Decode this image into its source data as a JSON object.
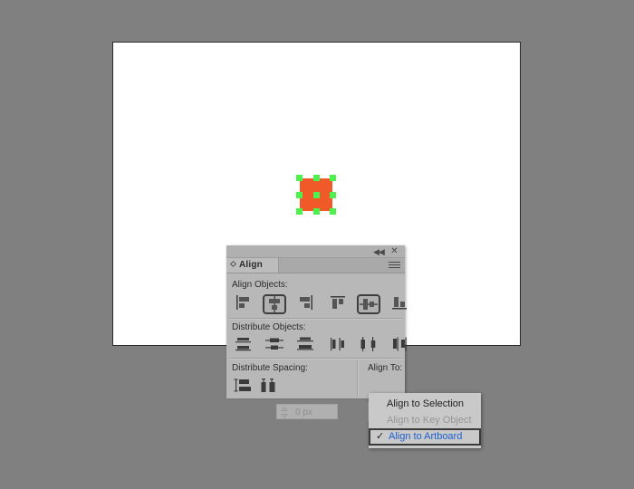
{
  "app": {
    "background_color": "#808080",
    "artboard_color": "#ffffff"
  },
  "shape": {
    "fill_color": "#ef5a28",
    "handle_color": "#4ef04e",
    "name": "selected-rectangle"
  },
  "panel": {
    "tab_label": "Align",
    "titlebar": {
      "collapse_icon": "◀◀",
      "close_icon": "✕"
    },
    "menu_icon": "panel-options-icon",
    "sections": {
      "align_objects_label": "Align Objects:",
      "distribute_objects_label": "Distribute Objects:",
      "distribute_spacing_label": "Distribute Spacing:",
      "align_to_label": "Align To:"
    },
    "align_objects_buttons": [
      {
        "name": "horizontal-align-left",
        "selected": false
      },
      {
        "name": "horizontal-align-center",
        "selected": true
      },
      {
        "name": "horizontal-align-right",
        "selected": false
      },
      {
        "name": "vertical-align-top",
        "selected": false
      },
      {
        "name": "vertical-align-center",
        "selected": true
      },
      {
        "name": "vertical-align-bottom",
        "selected": false
      }
    ],
    "distribute_objects_buttons": [
      {
        "name": "vertical-distribute-top",
        "selected": false
      },
      {
        "name": "vertical-distribute-center",
        "selected": false
      },
      {
        "name": "vertical-distribute-bottom",
        "selected": false
      },
      {
        "name": "horizontal-distribute-left",
        "selected": false
      },
      {
        "name": "horizontal-distribute-center",
        "selected": false
      },
      {
        "name": "horizontal-distribute-right",
        "selected": false
      }
    ],
    "distribute_spacing_buttons": [
      {
        "name": "vertical-distribute-spacing",
        "selected": false
      },
      {
        "name": "horizontal-distribute-spacing",
        "selected": false
      }
    ],
    "spacing_input": {
      "value": "0 px",
      "disabled": true
    },
    "align_to_button": {
      "name": "align-to-dropdown",
      "icon": "artboard-icon",
      "chevron": "chevron-down-icon"
    }
  },
  "dropdown": {
    "items": [
      {
        "label": "Align to Selection",
        "disabled": false,
        "checked": false
      },
      {
        "label": "Align to Key Object",
        "disabled": true,
        "checked": false
      },
      {
        "label": "Align to Artboard",
        "disabled": false,
        "checked": true
      }
    ],
    "check_glyph": "✓",
    "highlight_color": "#1a5fd0"
  }
}
